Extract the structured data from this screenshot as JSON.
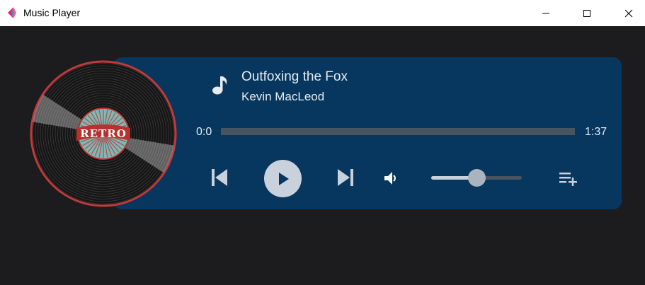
{
  "window": {
    "title": "Music Player",
    "controls": [
      "minimize",
      "maximize",
      "close"
    ]
  },
  "album_art": {
    "label": "RETRO",
    "icon": "vinyl-record"
  },
  "track": {
    "icon": "music-note-icon",
    "title": "Outfoxing the Fox",
    "artist": "Kevin MacLeod"
  },
  "progress": {
    "current": "0:0",
    "total": "1:37",
    "fraction": 0
  },
  "controls": {
    "previous_icon": "skip-previous-icon",
    "play_icon": "play-icon",
    "next_icon": "skip-next-icon",
    "volume_icon": "volume-icon",
    "playlist_icon": "playlist-add-icon"
  },
  "volume": {
    "level": 0.5
  },
  "colors": {
    "card": "#07375e",
    "background": "#1c1c1e",
    "text": "#e6ecf2",
    "disc_rim": "#c0393b",
    "label_teal": "#7fb8b5",
    "label_red": "#b7322f"
  }
}
